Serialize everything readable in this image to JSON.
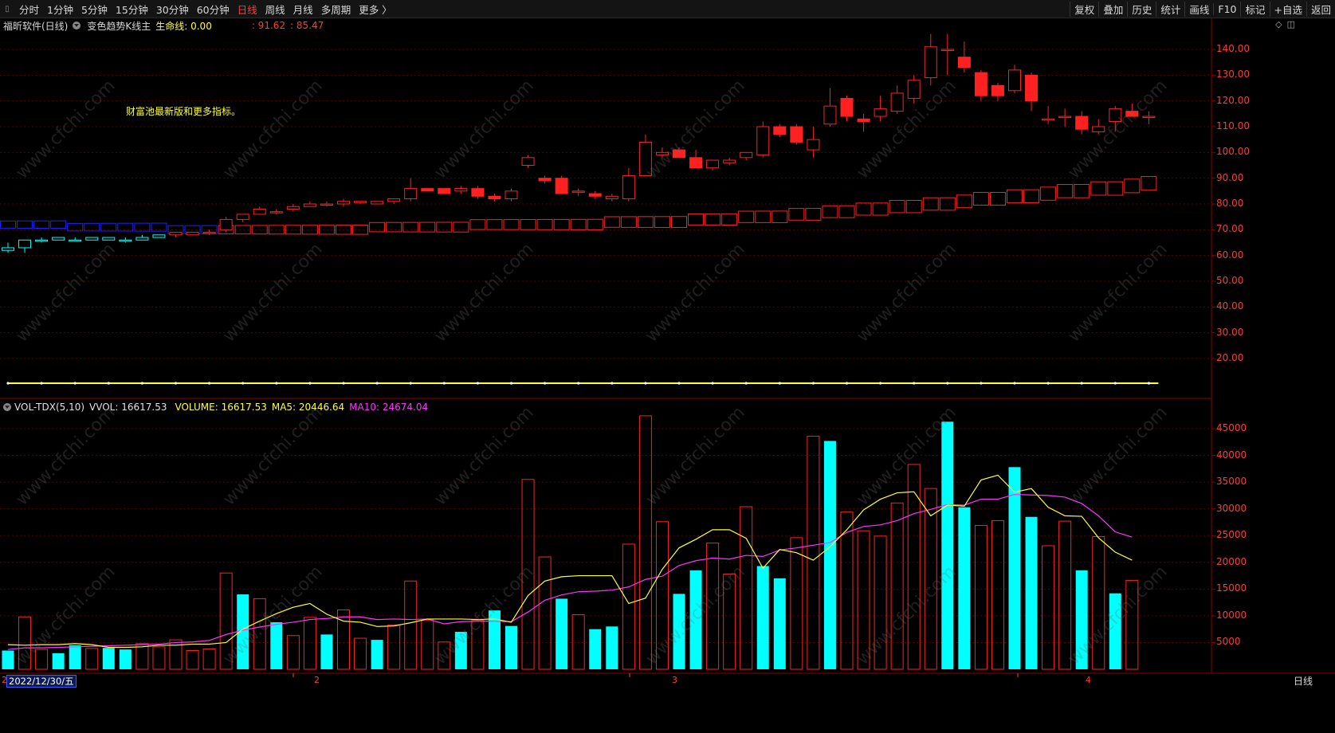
{
  "toolbar": {
    "tabs": [
      "分时",
      "1分钟",
      "5分钟",
      "15分钟",
      "30分钟",
      "60分钟",
      "日线",
      "周线",
      "月线",
      "多周期",
      "更多 〉"
    ],
    "active_tab": "日线",
    "tools": [
      "复权",
      "叠加",
      "历史",
      "统计",
      "画线",
      "F10",
      "标记",
      "+自选",
      "返回"
    ]
  },
  "main_panel": {
    "security": "福昕软件(日线)",
    "indicator": "变色趋势K线主",
    "life_line": "生命线: 0.00",
    "price_a": ": 91.62",
    "price_b": ": 85.47",
    "promo": "财富池最新版和更多指标。",
    "y_labels": [
      "140.00",
      "130.00",
      "120.00",
      "110.00",
      "100.00",
      "90.00",
      "80.00",
      "70.00",
      "60.00",
      "50.00",
      "40.00",
      "30.00",
      "20.00"
    ]
  },
  "volume_panel": {
    "name": "VOL-TDX(5,10)",
    "vvol": "VVOL: 16617.53",
    "volume": "VOLUME: 16617.53",
    "ma5": "MA5: 20446.64",
    "ma10": "MA10: 24674.04",
    "y_labels": [
      "45000",
      "40000",
      "35000",
      "30000",
      "25000",
      "20000",
      "15000",
      "10000",
      "5000"
    ]
  },
  "bottom": {
    "date": "2022/12/30/五",
    "tick_left": "2",
    "months": [
      "2",
      "3",
      "4"
    ],
    "period": "日线"
  },
  "watermark": "www.cfchi.com",
  "colors": {
    "up": "#ff2020",
    "down": "#00ffff",
    "blue_band": "#2020ff",
    "yellow": "#ffff33",
    "magenta": "#ff33ff",
    "grid": "#5a0000"
  },
  "chart_data": [
    {
      "type": "candlestick",
      "title": "福昕软件(日线)",
      "ylim": [
        0,
        150
      ],
      "candles": [
        [
          62,
          65,
          61,
          63,
          "d"
        ],
        [
          63,
          66,
          61,
          66,
          "d"
        ],
        [
          66,
          67,
          65,
          66,
          "d"
        ],
        [
          66,
          67,
          66,
          67,
          "d"
        ],
        [
          66,
          67,
          66,
          66,
          "d"
        ],
        [
          66,
          67,
          66,
          67,
          "d"
        ],
        [
          66,
          67,
          66,
          67,
          "d"
        ],
        [
          66,
          67,
          65,
          66,
          "d"
        ],
        [
          66,
          68,
          66,
          67,
          "d"
        ],
        [
          67,
          68,
          67,
          68,
          "d"
        ],
        [
          68,
          69,
          67,
          69,
          "u"
        ],
        [
          68,
          69,
          68,
          69,
          "u"
        ],
        [
          69,
          70,
          68,
          69,
          "u"
        ],
        [
          70,
          75,
          69,
          74,
          "u"
        ],
        [
          74,
          76,
          73,
          76,
          "u"
        ],
        [
          76,
          79,
          76,
          78,
          "u"
        ],
        [
          77,
          78,
          76,
          77,
          "u"
        ],
        [
          78,
          80,
          77,
          79,
          "u"
        ],
        [
          79,
          81,
          79,
          80,
          "u"
        ],
        [
          80,
          81,
          79,
          80,
          "u"
        ],
        [
          80,
          82,
          79,
          81,
          "u"
        ],
        [
          81,
          81,
          80,
          81,
          "u"
        ],
        [
          80,
          81,
          80,
          81,
          "u"
        ],
        [
          81,
          82,
          80,
          82,
          "u"
        ],
        [
          82,
          90,
          81,
          86,
          "u"
        ],
        [
          86,
          86,
          85,
          85,
          "u"
        ],
        [
          86,
          86,
          84,
          84,
          "u"
        ],
        [
          85,
          87,
          84,
          86,
          "u"
        ],
        [
          86,
          87,
          82,
          83,
          "u"
        ],
        [
          83,
          84,
          81,
          82,
          "u"
        ],
        [
          82,
          86,
          81,
          85,
          "u"
        ],
        [
          95,
          99,
          94,
          98,
          "u"
        ],
        [
          90,
          91,
          88,
          89,
          "u"
        ],
        [
          90,
          91,
          84,
          84,
          "u"
        ],
        [
          85,
          86,
          83,
          85,
          "u"
        ],
        [
          84,
          85,
          82,
          83,
          "u"
        ],
        [
          82,
          84,
          81,
          83,
          "u"
        ],
        [
          82,
          94,
          81,
          91,
          "u"
        ],
        [
          91,
          107,
          91,
          104,
          "u"
        ],
        [
          99,
          102,
          98,
          100,
          "u"
        ],
        [
          101,
          102,
          98,
          98,
          "u"
        ],
        [
          98,
          101,
          94,
          94,
          "u"
        ],
        [
          94,
          97,
          93,
          97,
          "u"
        ],
        [
          96,
          98,
          95,
          97,
          "u"
        ],
        [
          98,
          100,
          97,
          100,
          "u"
        ],
        [
          99,
          112,
          98,
          110,
          "u"
        ],
        [
          110,
          111,
          106,
          107,
          "u"
        ],
        [
          110,
          111,
          103,
          104,
          "u"
        ],
        [
          101,
          110,
          98,
          105,
          "u"
        ],
        [
          111,
          125,
          110,
          118,
          "u"
        ],
        [
          121,
          122,
          112,
          114,
          "u"
        ],
        [
          113,
          115,
          108,
          112,
          "u"
        ],
        [
          114,
          122,
          112,
          117,
          "u"
        ],
        [
          116,
          126,
          115,
          123,
          "u"
        ],
        [
          121,
          130,
          119,
          128,
          "u"
        ],
        [
          129,
          146,
          126,
          141,
          "u"
        ],
        [
          140,
          146,
          130,
          140,
          "u"
        ],
        [
          137,
          143,
          131,
          133,
          "u"
        ],
        [
          131,
          132,
          120,
          122,
          "u"
        ],
        [
          126,
          127,
          120,
          122,
          "u"
        ],
        [
          124,
          134,
          123,
          132,
          "u"
        ],
        [
          130,
          131,
          116,
          120,
          "u"
        ],
        [
          113,
          118,
          111,
          113,
          "u"
        ],
        [
          114,
          117,
          110,
          114,
          "u"
        ],
        [
          114,
          116,
          107,
          109,
          "u"
        ],
        [
          108,
          113,
          107,
          110,
          "u"
        ],
        [
          112,
          118,
          108,
          117,
          "u"
        ],
        [
          116,
          119,
          114,
          114,
          "u"
        ],
        [
          114,
          116,
          111,
          114,
          "u"
        ]
      ],
      "trend_line": [
        72,
        72,
        72,
        72,
        71,
        71,
        71,
        71,
        71,
        71,
        70,
        70,
        70,
        70,
        70,
        70,
        70,
        70,
        70,
        70,
        70,
        70,
        71,
        71,
        71,
        71,
        71,
        71,
        72,
        72,
        72,
        72,
        72,
        72,
        72,
        72,
        73,
        73,
        73,
        73,
        73,
        74,
        74,
        74,
        75,
        75,
        75,
        76,
        76,
        77,
        77,
        78,
        78,
        79,
        79,
        80,
        80,
        81,
        82,
        82,
        83,
        83,
        84,
        85,
        85,
        86,
        86,
        87,
        88
      ],
      "life_line": 6
    },
    {
      "type": "bar",
      "title": "VOL-TDX(5,10)",
      "ylim": [
        0,
        48000
      ],
      "values": [
        3500,
        9800,
        3700,
        3000,
        4500,
        3900,
        4000,
        3700,
        4800,
        4200,
        5500,
        3500,
        3800,
        18000,
        14000,
        13200,
        8800,
        6300,
        9700,
        6500,
        11100,
        5800,
        5500,
        8300,
        16500,
        9200,
        5100,
        7000,
        9200,
        11000,
        8100,
        35500,
        21000,
        13200,
        10200,
        7500,
        8000,
        23400,
        47400,
        27600,
        14100,
        18500,
        23600,
        17800,
        30400,
        19300,
        17000,
        24600,
        43600,
        42700,
        29400,
        25900,
        24900,
        31100,
        38300,
        33800,
        46300,
        30300,
        26900,
        27800,
        37800,
        28500,
        23100,
        27700,
        18500,
        24800,
        14200,
        16600
      ],
      "down": [
        0,
        3,
        4,
        6,
        7,
        14,
        16,
        19,
        22,
        27,
        29,
        30,
        33,
        35,
        36,
        40,
        41,
        45,
        46,
        49,
        56,
        57,
        60,
        61,
        64,
        66
      ],
      "ma5": [
        4600,
        4500,
        4600,
        4600,
        4800,
        4600,
        4100,
        4100,
        4200,
        4500,
        4500,
        4700,
        4700,
        5000,
        7500,
        9000,
        10400,
        11600,
        12300,
        10300,
        9000,
        8800,
        8000,
        8100,
        8700,
        9400,
        9400,
        9400,
        9300,
        9400,
        8800,
        13800,
        16500,
        17300,
        17500,
        17500,
        17500,
        12300,
        13300,
        18700,
        22700,
        24300,
        26100,
        26100,
        24500,
        18900,
        22400,
        21800,
        20400,
        22900,
        26100,
        29800,
        31800,
        33000,
        33200,
        28700,
        30700,
        30500,
        35400,
        36300,
        33100,
        33800,
        30300,
        28700,
        28600,
        24600,
        21900,
        20400
      ],
      "ma10": [
        3700,
        4000,
        4000,
        4100,
        4200,
        4300,
        4400,
        4500,
        4600,
        4700,
        5000,
        5100,
        5400,
        6500,
        7300,
        7900,
        8400,
        8800,
        9300,
        9500,
        9800,
        9800,
        9300,
        9400,
        9300,
        9400,
        8500,
        8900,
        9000,
        9000,
        8900,
        10700,
        12900,
        13900,
        14500,
        14600,
        14800,
        15400,
        16800,
        17400,
        19400,
        20300,
        20800,
        20600,
        21300,
        21100,
        22300,
        22700,
        23200,
        23700,
        25600,
        26700,
        27000,
        27800,
        29100,
        29900,
        30800,
        30700,
        31800,
        31800,
        32700,
        32600,
        32500,
        32200,
        31000,
        28700,
        25700,
        24700
      ]
    }
  ]
}
